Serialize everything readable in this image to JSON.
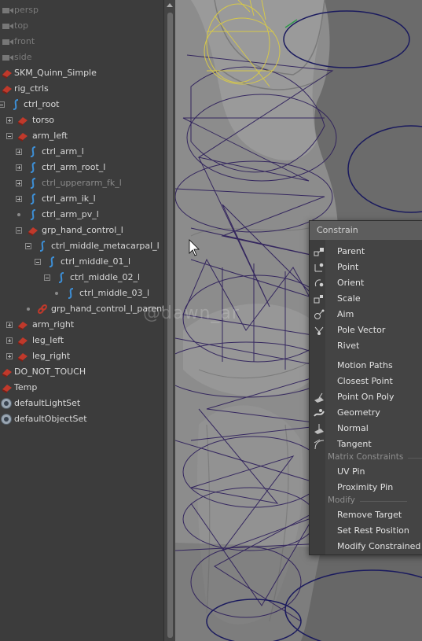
{
  "outliner": {
    "items": [
      {
        "label": "persp",
        "icon": "camera-icon",
        "style": "dim"
      },
      {
        "label": "top",
        "icon": "camera-icon",
        "style": "dim"
      },
      {
        "label": "front",
        "icon": "camera-icon",
        "style": "dim"
      },
      {
        "label": "side",
        "icon": "camera-icon",
        "style": "dim"
      },
      {
        "label": "SKM_Quinn_Simple",
        "icon": "transform-icon"
      },
      {
        "label": "rig_ctrls",
        "icon": "transform-icon"
      },
      {
        "label": "ctrl_root",
        "icon": "nurbs-curve-icon"
      },
      {
        "label": "torso",
        "icon": "transform-icon"
      },
      {
        "label": "arm_left",
        "icon": "transform-icon"
      },
      {
        "label": "ctrl_arm_l",
        "icon": "nurbs-curve-icon"
      },
      {
        "label": "ctrl_arm_root_l",
        "icon": "nurbs-curve-icon"
      },
      {
        "label": "ctrl_upperarm_fk_l",
        "icon": "nurbs-curve-icon",
        "style": "faded"
      },
      {
        "label": "ctrl_arm_ik_l",
        "icon": "nurbs-curve-icon"
      },
      {
        "label": "ctrl_arm_pv_l",
        "icon": "nurbs-curve-icon"
      },
      {
        "label": "grp_hand_control_l",
        "icon": "transform-icon"
      },
      {
        "label": "ctrl_middle_metacarpal_l",
        "icon": "nurbs-curve-icon"
      },
      {
        "label": "ctrl_middle_01_l",
        "icon": "nurbs-curve-icon"
      },
      {
        "label": "ctrl_middle_02_l",
        "icon": "nurbs-curve-icon"
      },
      {
        "label": "ctrl_middle_03_l",
        "icon": "nurbs-curve-icon"
      },
      {
        "label": "grp_hand_control_l_parentC",
        "icon": "constraint-icon"
      },
      {
        "label": "arm_right",
        "icon": "transform-icon"
      },
      {
        "label": "leg_left",
        "icon": "transform-icon"
      },
      {
        "label": "leg_right",
        "icon": "transform-icon"
      },
      {
        "label": "DO_NOT_TOUCH",
        "icon": "transform-icon"
      },
      {
        "label": "Temp",
        "icon": "transform-icon"
      },
      {
        "label": "defaultLightSet",
        "icon": "set-icon"
      },
      {
        "label": "defaultObjectSet",
        "icon": "set-icon"
      }
    ]
  },
  "watermark": "@dawn_ar",
  "menu": {
    "title": "Constrain",
    "items": [
      {
        "label": "Parent",
        "icon": "parent-constraint-icon"
      },
      {
        "label": "Point",
        "icon": "point-constraint-icon"
      },
      {
        "label": "Orient",
        "icon": "orient-constraint-icon"
      },
      {
        "label": "Scale",
        "icon": "scale-constraint-icon"
      },
      {
        "label": "Aim",
        "icon": "aim-constraint-icon"
      },
      {
        "label": "Pole Vector",
        "icon": "pole-vector-icon"
      },
      {
        "label": "Rivet",
        "icon": "rivet-icon"
      },
      {
        "label": "Motion Paths",
        "icon": ""
      },
      {
        "label": "Closest Point",
        "icon": ""
      },
      {
        "label": "Point On Poly",
        "icon": "point-on-poly-icon"
      },
      {
        "label": "Geometry",
        "icon": "geometry-constraint-icon"
      },
      {
        "label": "Normal",
        "icon": "normal-constraint-icon"
      },
      {
        "label": "Tangent",
        "icon": "tangent-constraint-icon"
      },
      {
        "label": "UV Pin",
        "icon": ""
      },
      {
        "label": "Proximity Pin",
        "icon": ""
      },
      {
        "label": "Remove Target",
        "icon": ""
      },
      {
        "label": "Set Rest Position",
        "icon": ""
      },
      {
        "label": "Modify Constrained A",
        "icon": ""
      }
    ],
    "sections": [
      "Matrix Constraints",
      "Modify"
    ]
  },
  "colors": {
    "outliner_bg": "#3c3c3c",
    "curve_blue": "#3d8fd6",
    "transform_red": "#c0392b",
    "wire_purple": "#2b1c5a",
    "wire_yellow": "#d6c84a",
    "wire_navy": "#1a1a5e"
  }
}
